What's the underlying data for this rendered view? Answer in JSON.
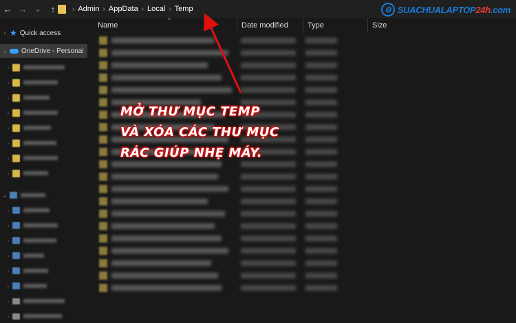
{
  "address_bar": {
    "crumbs": [
      "Admin",
      "AppData",
      "Local",
      "Temp"
    ],
    "separator": "›"
  },
  "logo": {
    "text_blue": "SUACHUALAPTOP",
    "text_red": "24h",
    "text_tail": ".com"
  },
  "sidebar": {
    "quick_access": "Quick access",
    "onedrive": "OneDrive - Personal"
  },
  "columns": {
    "name": "Name",
    "date_modified": "Date modified",
    "type": "Type",
    "size": "Size"
  },
  "annotation": {
    "line1": "Mở thư mục Temp",
    "line2": "và xóa các thư mục",
    "line3": "rác giúp nhẹ máy."
  },
  "colors": {
    "accent_blue": "#1a7bd8",
    "annotation_outline": "#e01010",
    "arrow": "#e01010"
  }
}
